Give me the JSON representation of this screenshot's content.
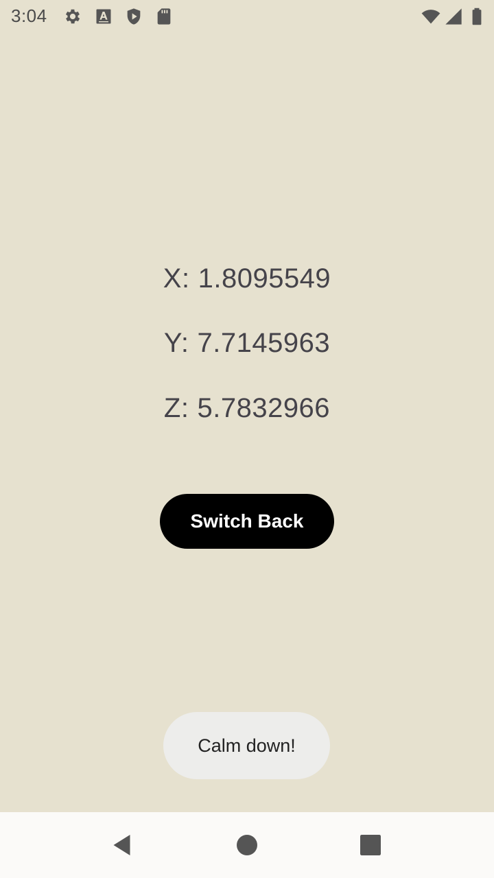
{
  "status_bar": {
    "time": "3:04",
    "left_icons": [
      "gear-icon",
      "font-a-icon",
      "shield-play-icon",
      "sd-card-icon"
    ],
    "right_icons": [
      "wifi-icon",
      "signal-icon",
      "battery-icon"
    ]
  },
  "readouts": [
    {
      "axis": "X:",
      "value": "1.8095549"
    },
    {
      "axis": "Y:",
      "value": "7.7145963"
    },
    {
      "axis": "Z:",
      "value": "5.7832966"
    }
  ],
  "button": {
    "label": "Switch Back"
  },
  "toast": {
    "message": "Calm down!"
  },
  "nav_bar": {
    "buttons": [
      "back-icon",
      "home-icon",
      "recents-icon"
    ]
  },
  "colors": {
    "background": "#e6e1cf",
    "text": "#45434a",
    "button_bg": "#000000",
    "button_text": "#ffffff",
    "toast_bg": "#ededeb",
    "nav_bg": "#fbfaf8"
  }
}
